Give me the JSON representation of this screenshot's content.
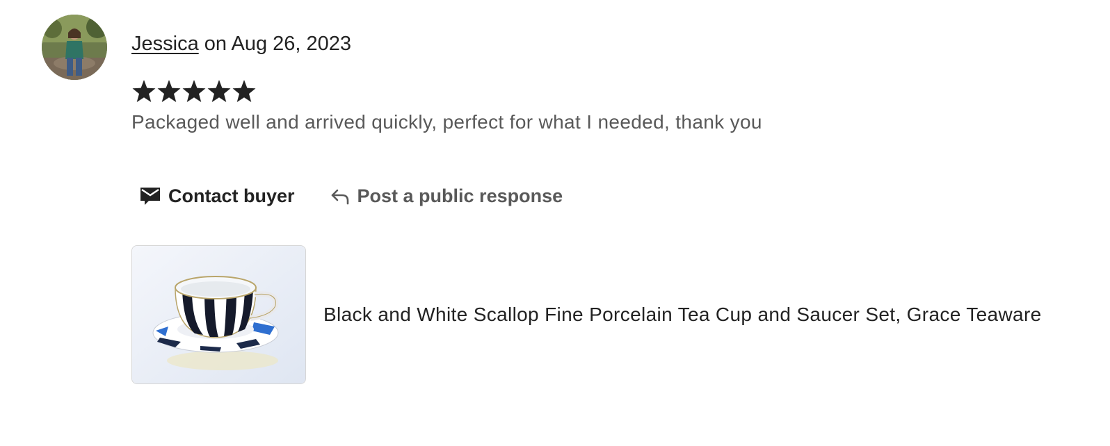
{
  "reviewer": {
    "name": "Jessica",
    "date_text": "on Aug 26, 2023",
    "avatar": "reviewer-photo"
  },
  "review": {
    "rating": 5,
    "rating_max": 5,
    "text": "Packaged well and arrived quickly, perfect for what I needed, thank you"
  },
  "actions": {
    "contact_label": "Contact buyer",
    "contact_icon": "envelope-icon",
    "respond_label": "Post a public response",
    "respond_icon": "reply-arrow-icon"
  },
  "listing": {
    "title": "Black and White Scallop Fine Porcelain Tea Cup and Saucer Set, Grace Teaware",
    "image": "teacup-saucer-photo"
  },
  "colors": {
    "primary_text": "#222222",
    "secondary_text": "#595959",
    "star": "#222222"
  }
}
